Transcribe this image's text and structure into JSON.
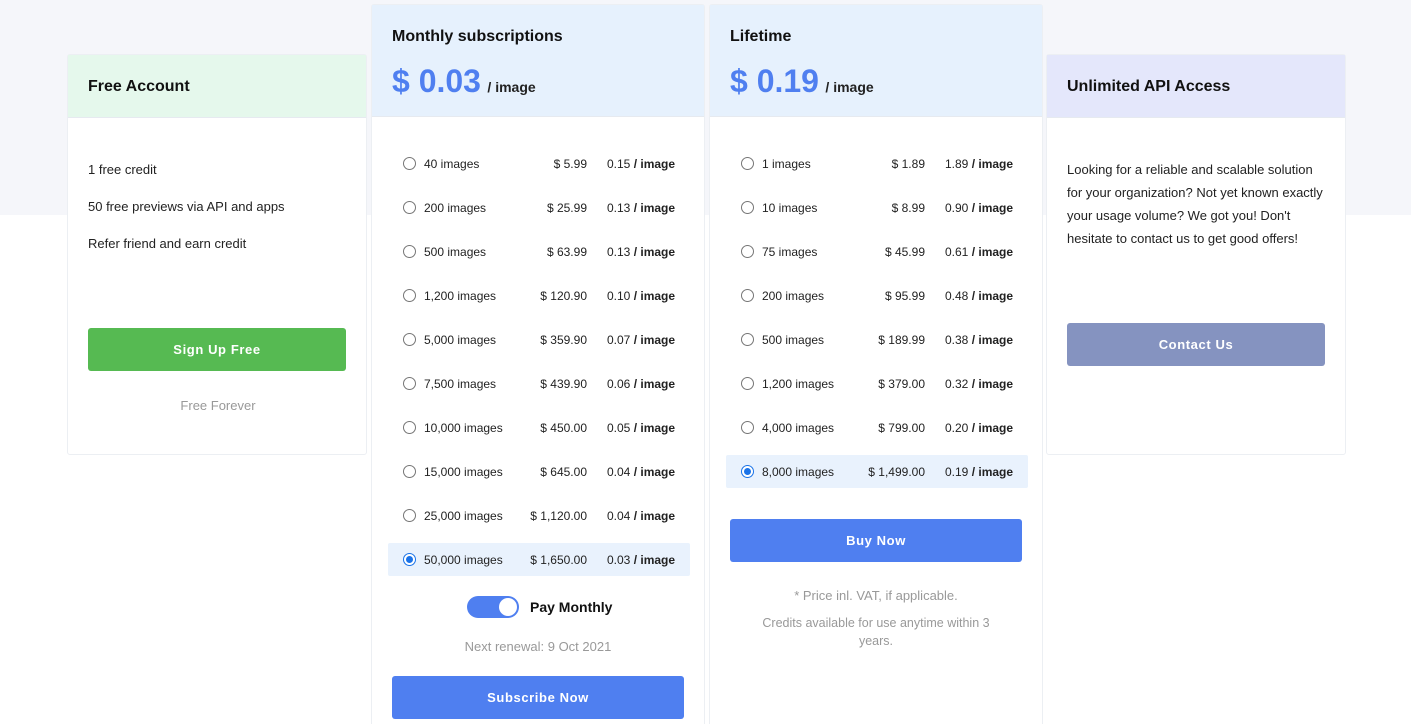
{
  "free": {
    "title": "Free Account",
    "features": [
      "1 free credit",
      "50 free previews via API and apps",
      "Refer friend and earn credit"
    ],
    "button": "Sign Up Free",
    "note": "Free Forever",
    "header_color": "#e5f8ec",
    "button_color": "#56ba52"
  },
  "monthly": {
    "title": "Monthly subscriptions",
    "price": "$ 0.03",
    "unit": "/ image",
    "header_color": "#e6f1fd",
    "rows": [
      {
        "images": "40 images",
        "price": "$ 5.99",
        "per": "0.15",
        "unit": "/ image",
        "selected": false
      },
      {
        "images": "200 images",
        "price": "$ 25.99",
        "per": "0.13",
        "unit": "/ image",
        "selected": false
      },
      {
        "images": "500 images",
        "price": "$ 63.99",
        "per": "0.13",
        "unit": "/ image",
        "selected": false
      },
      {
        "images": "1,200 images",
        "price": "$ 120.90",
        "per": "0.10",
        "unit": "/ image",
        "selected": false
      },
      {
        "images": "5,000 images",
        "price": "$ 359.90",
        "per": "0.07",
        "unit": "/ image",
        "selected": false
      },
      {
        "images": "7,500 images",
        "price": "$ 439.90",
        "per": "0.06",
        "unit": "/ image",
        "selected": false
      },
      {
        "images": "10,000 images",
        "price": "$ 450.00",
        "per": "0.05",
        "unit": "/ image",
        "selected": false
      },
      {
        "images": "15,000 images",
        "price": "$ 645.00",
        "per": "0.04",
        "unit": "/ image",
        "selected": false
      },
      {
        "images": "25,000 images",
        "price": "$ 1,120.00",
        "per": "0.04",
        "unit": "/ image",
        "selected": false
      },
      {
        "images": "50,000 images",
        "price": "$ 1,650.00",
        "per": "0.03",
        "unit": "/ image",
        "selected": true
      }
    ],
    "toggle_label": "Pay Monthly",
    "toggle_on": true,
    "renewal": "Next renewal: 9 Oct 2021",
    "button": "Subscribe Now",
    "button_color": "#4f7ff0"
  },
  "lifetime": {
    "title": "Lifetime",
    "price": "$ 0.19",
    "unit": "/ image",
    "header_color": "#e6f1fd",
    "rows": [
      {
        "images": "1 images",
        "price": "$ 1.89",
        "per": "1.89",
        "unit": "/ image",
        "selected": false
      },
      {
        "images": "10 images",
        "price": "$ 8.99",
        "per": "0.90",
        "unit": "/ image",
        "selected": false
      },
      {
        "images": "75 images",
        "price": "$ 45.99",
        "per": "0.61",
        "unit": "/ image",
        "selected": false
      },
      {
        "images": "200 images",
        "price": "$ 95.99",
        "per": "0.48",
        "unit": "/ image",
        "selected": false
      },
      {
        "images": "500 images",
        "price": "$ 189.99",
        "per": "0.38",
        "unit": "/ image",
        "selected": false
      },
      {
        "images": "1,200 images",
        "price": "$ 379.00",
        "per": "0.32",
        "unit": "/ image",
        "selected": false
      },
      {
        "images": "4,000 images",
        "price": "$ 799.00",
        "per": "0.20",
        "unit": "/ image",
        "selected": false
      },
      {
        "images": "8,000 images",
        "price": "$ 1,499.00",
        "per": "0.19",
        "unit": "/ image",
        "selected": true
      }
    ],
    "button": "Buy Now",
    "button_color": "#4f7ff0",
    "vat_note": "* Price inl. VAT, if applicable.",
    "credits_note_line1": "Credits available for use anytime within 3",
    "credits_note_line2": "years."
  },
  "api": {
    "title": "Unlimited API Access",
    "description": "Looking for a reliable and scalable solution for your organization? Not yet known exactly your usage volume? We got you! Don't hesitate to contact us to get good offers!",
    "button": "Contact Us",
    "header_color": "#e4e7fb",
    "button_color": "#8593c0"
  }
}
